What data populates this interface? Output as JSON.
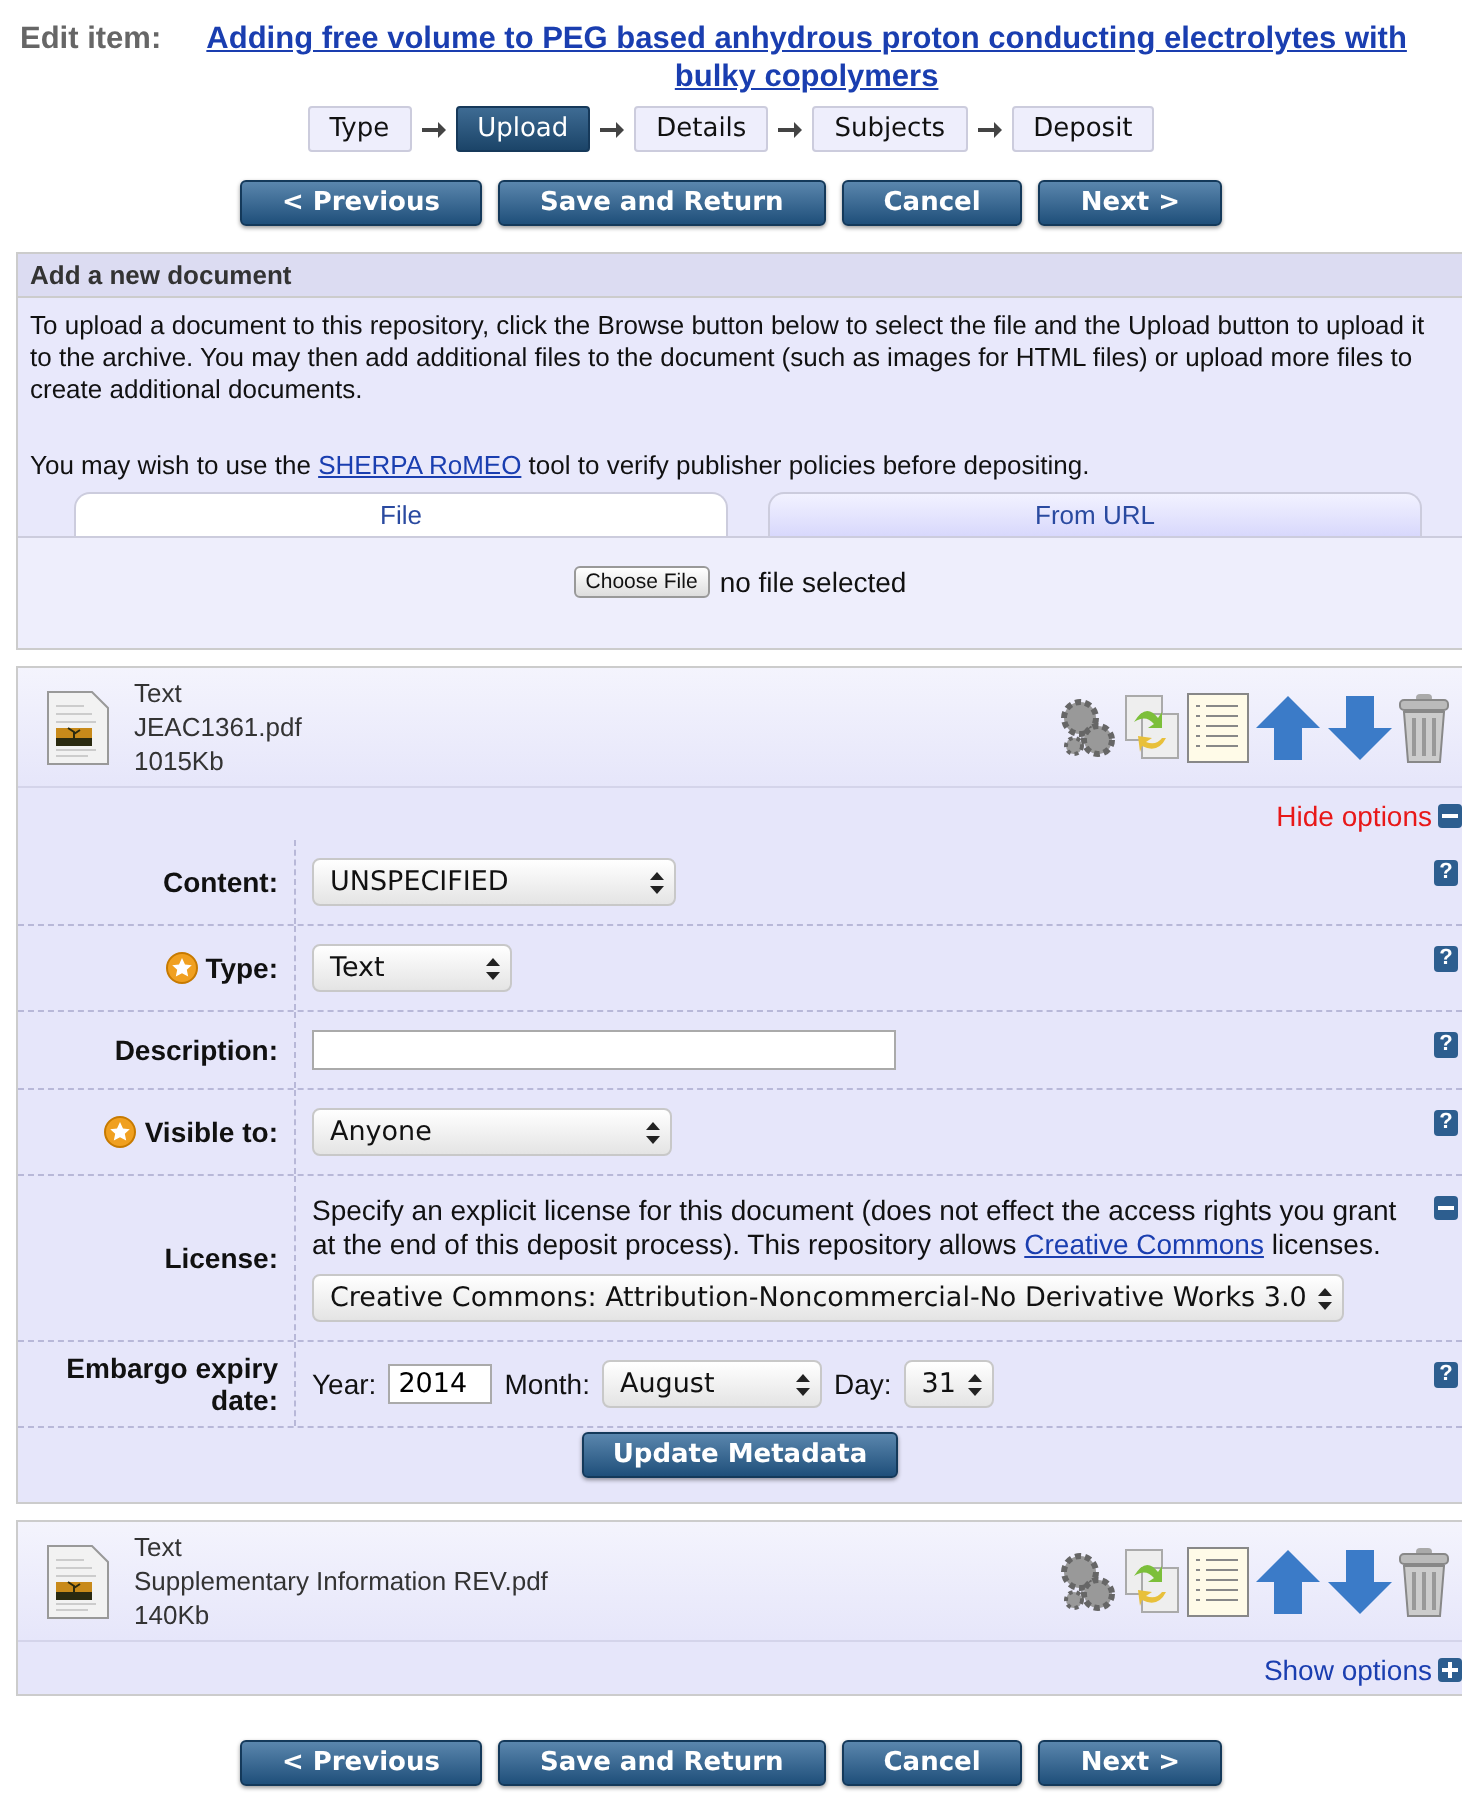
{
  "header": {
    "label": "Edit item:",
    "title": "Adding free volume to PEG based anhydrous proton conducting electrolytes with bulky copolymers"
  },
  "steps": [
    {
      "label": "Type",
      "selected": false
    },
    {
      "label": "Upload",
      "selected": true
    },
    {
      "label": "Details",
      "selected": false
    },
    {
      "label": "Subjects",
      "selected": false
    },
    {
      "label": "Deposit",
      "selected": false
    }
  ],
  "nav_buttons_top": [
    "< Previous",
    "Save and Return",
    "Cancel",
    "Next >"
  ],
  "add_document": {
    "title": "Add a new document",
    "intro": "To upload a document to this repository, click the Browse button below to select the file and the Upload button to upload it to the archive. You may then add additional files to the document (such as images for HTML files) or upload more files to create additional documents.",
    "note_before": "You may wish to use the",
    "note_link": "SHERPA RoMEO",
    "note_after": "tool to verify publisher policies before depositing.",
    "tabs": [
      {
        "label": "File",
        "selected": true
      },
      {
        "label": "From URL",
        "selected": false
      }
    ],
    "file_button": "Choose File",
    "file_status": "no file selected"
  },
  "documents": [
    {
      "type": "Text",
      "filename": "JEAC1361.pdf",
      "size": "1015Kb",
      "expanded": true,
      "toggle_label": "Hide options",
      "fields": [
        {
          "kind": "select",
          "label": "Content:",
          "required": false,
          "value": "UNSPECIFIED",
          "help": "?"
        },
        {
          "kind": "select",
          "label": "Type:",
          "required": true,
          "value": "Text",
          "help": "?"
        },
        {
          "kind": "input",
          "label": "Description:",
          "required": false,
          "help": "?"
        },
        {
          "kind": "select",
          "label": "Visible to:",
          "required": true,
          "value": "Anyone",
          "help": "?"
        },
        {
          "kind": "license",
          "label": "License:",
          "required": false,
          "text_before": "Specify an explicit license for this document (does not effect the access rights you grant at the end of this deposit process). This repository allows",
          "link": "Creative Commons",
          "text_after": "licenses.",
          "value": "Creative Commons: Attribution-Noncommercial-No Derivative Works 3.0"
        },
        {
          "kind": "date",
          "label": "Embargo expiry date:",
          "required": false,
          "year_label": "Year:",
          "year": "2014",
          "month_label": "Month:",
          "month": "August",
          "day_label": "Day:",
          "day": "31",
          "help": "?"
        }
      ],
      "update_button": "Update Metadata"
    },
    {
      "type": "Text",
      "filename": "Supplementary Information REV.pdf",
      "size": "140Kb",
      "expanded": false,
      "toggle_label": "Show options"
    }
  ],
  "nav_buttons_bottom": [
    "< Previous",
    "Save and Return",
    "Cancel",
    "Next >"
  ]
}
